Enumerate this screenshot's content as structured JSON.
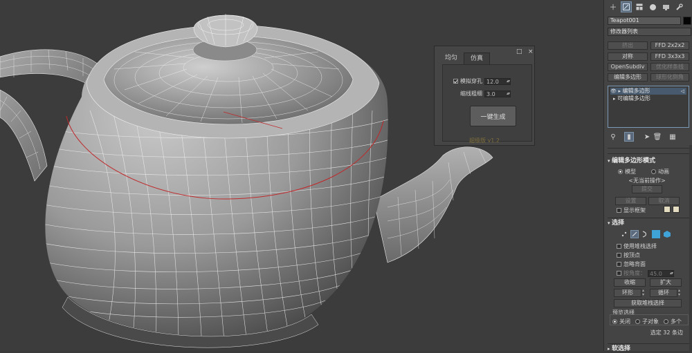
{
  "floater": {
    "tabs": [
      "均匀",
      "仿真"
    ],
    "active_tab": "仿真",
    "restore_glyph": "□",
    "close_glyph": "×",
    "chk_label": "模拟穿孔",
    "chk_value": "12.0",
    "thick_label": "缩线粗细",
    "thick_value": "3.0",
    "generate_btn": "一键生成",
    "version": "超级版 v1.2"
  },
  "cmd": {
    "object_name": "Teapot001",
    "modlist_label": "修改器列表",
    "btn_grid": [
      [
        "挤出",
        "FFD 2x2x2"
      ],
      [
        "对称",
        "FFD 3x3x3"
      ],
      [
        "OpenSubdiv",
        "优化样条线"
      ],
      [
        "编辑多边形",
        "球形化倒角"
      ]
    ],
    "stack_items": [
      "编辑多边形",
      "可编辑多边形"
    ],
    "edit_poly_hdr": "编辑多边形模式",
    "mode_model": "模型",
    "mode_anim": "动画",
    "no_op": "<无当前操作>",
    "commit": "提交",
    "settings": "设置",
    "cancel": "取消",
    "show_cage": "显示框架",
    "selection_hdr": "选择",
    "use_stack_sel": "使用堆栈选择",
    "by_vertex": "按顶点",
    "ignore_back": "忽略背面",
    "by_angle": "按角度：",
    "angle_value": "45.0",
    "shrink": "收缩",
    "grow": "扩大",
    "ring": "环形",
    "loop": "循环",
    "get_stack_sel": "获取堆栈选择",
    "preview_sel": "预览选择",
    "preview_off": "关闭",
    "preview_sub": "子对象",
    "preview_multi": "多个",
    "selected_count": "选定 32 条边",
    "next_hdr": "软选择"
  },
  "icons": {
    "create": "plus-icon",
    "modify": "modify-icon",
    "hierarchy": "hierarchy-icon",
    "motion": "motion-icon",
    "display": "display-icon",
    "utilities": "wrench-icon"
  }
}
